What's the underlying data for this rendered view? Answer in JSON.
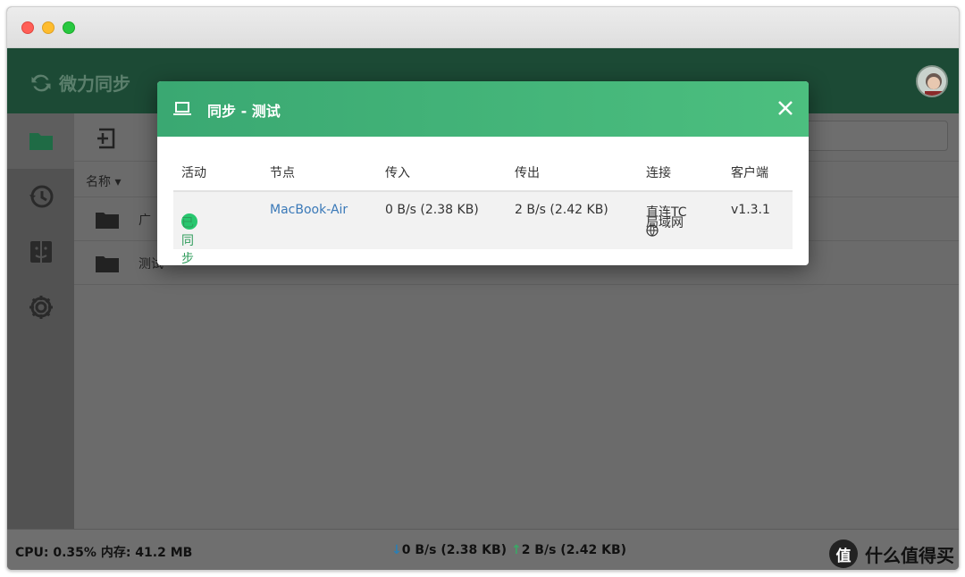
{
  "app": {
    "name": "微力同步"
  },
  "sidebar": {
    "items": [
      {
        "icon": "folder-icon"
      },
      {
        "icon": "history-icon"
      },
      {
        "icon": "finder-icon"
      },
      {
        "icon": "gear-icon"
      }
    ]
  },
  "main": {
    "column_header": "名称 ▾",
    "rows": [
      {
        "name": "广",
        "faded": ""
      },
      {
        "name": "测试",
        "faded": ""
      }
    ]
  },
  "status": {
    "cpu_mem": "CPU: 0.35% 内存: 41.2 MB",
    "down_arrow": "↓",
    "down": "0 B/s (2.38 KB)",
    "up_arrow": "↑",
    "up": "2 B/s (2.42 KB)"
  },
  "modal": {
    "title": "同步 - 测试",
    "columns": [
      "活动",
      "节点",
      "传入",
      "传出",
      "连接",
      "客户端"
    ],
    "rows": [
      {
        "activity": "已同步",
        "node": "MacBook-Air",
        "incoming": "0 B/s (2.38 KB)",
        "outgoing": "2 B/s (2.42 KB)",
        "connection": "直连TC",
        "connection_scope": "局域网",
        "client": "v1.3.1"
      }
    ]
  },
  "watermark": {
    "badge": "值",
    "text": "什么值得买"
  },
  "colors": {
    "accent": "#3aa872",
    "status_synced": "#28c76f",
    "link": "#3a79b8"
  }
}
